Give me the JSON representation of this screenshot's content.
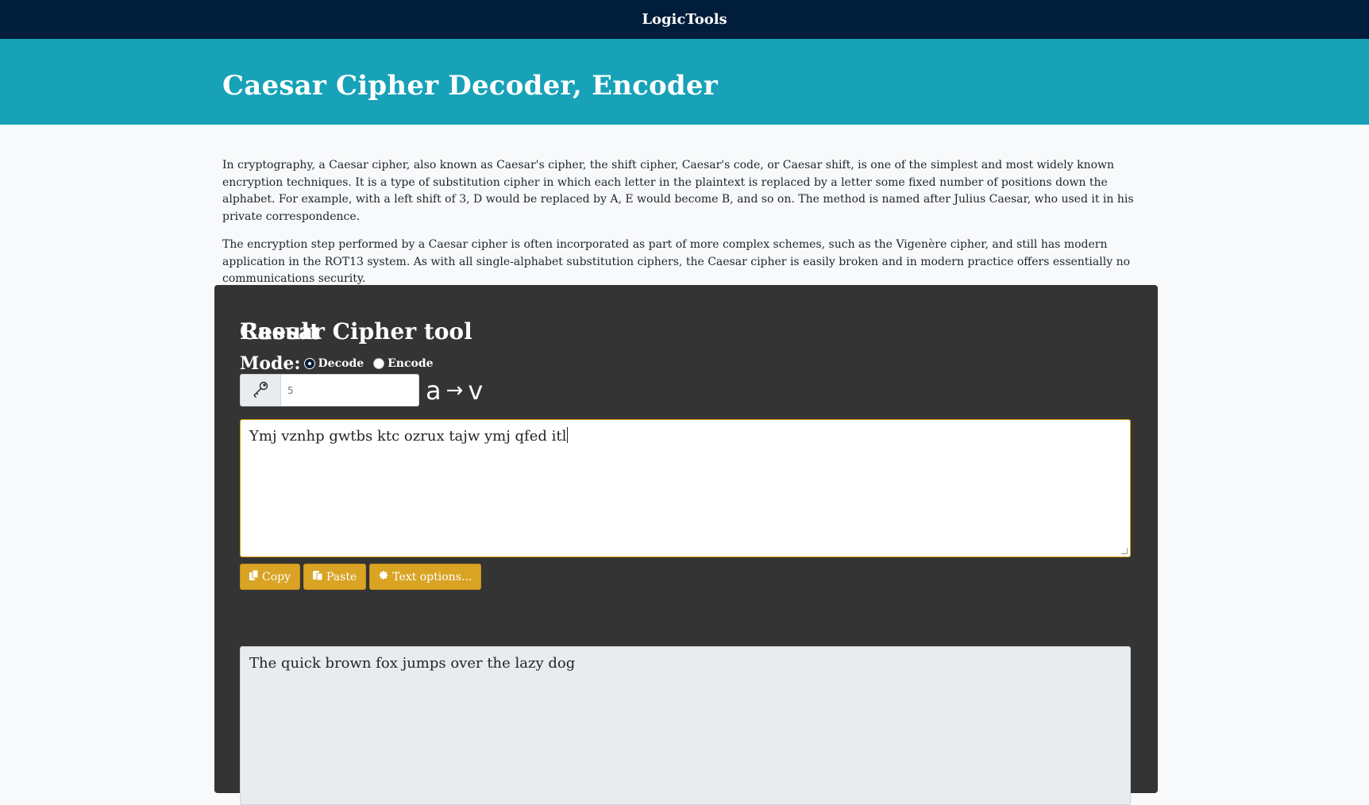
{
  "navbar": {
    "brand": "LogicTools"
  },
  "hero": {
    "title": "Caesar Cipher Decoder, Encoder"
  },
  "intro": {
    "paragraph1": "In cryptography, a Caesar cipher, also known as Caesar's cipher, the shift cipher, Caesar's code, or Caesar shift, is one of the simplest and most widely known encryption techniques. It is a type of substitution cipher in which each letter in the plaintext is replaced by a letter some fixed number of positions down the alphabet. For example, with a left shift of 3, D would be replaced by A, E would become B, and so on. The method is named after Julius Caesar, who used it in his private correspondence.",
    "paragraph2": "The encryption step performed by a Caesar cipher is often incorporated as part of more complex schemes, such as the Vigenère cipher, and still has modern application in the ROT13 system. As with all single-alphabet substitution ciphers, the Caesar cipher is easily broken and in modern practice offers essentially no communications security."
  },
  "tool": {
    "title": "Caesar Cipher tool",
    "mode_label": "Mode:",
    "modes": [
      {
        "label": "Decode",
        "checked": true
      },
      {
        "label": "Encode",
        "checked": false
      }
    ],
    "key_icon": "key-icon",
    "shift_placeholder": "5",
    "mapping_from": "a",
    "mapping_arrow": "→",
    "mapping_to": "v",
    "input_text": "Ymj vznhp gwtbs ktc ozrux tajw ymj qfed itl",
    "buttons": {
      "copy": "Copy",
      "paste": "Paste",
      "text_options": "Text options..."
    },
    "button_icons": {
      "copy": "copy-icon",
      "paste": "paste-icon",
      "text_options": "gear-icon"
    },
    "result_title": "Result",
    "result_text": "The quick brown fox jumps over the lazy dog"
  },
  "colors": {
    "navbar_bg": "#001d3b",
    "hero_bg": "#17a2b8",
    "tool_bg": "#343434",
    "button_bg": "#d9a323",
    "result_bg": "#e9ecef"
  }
}
